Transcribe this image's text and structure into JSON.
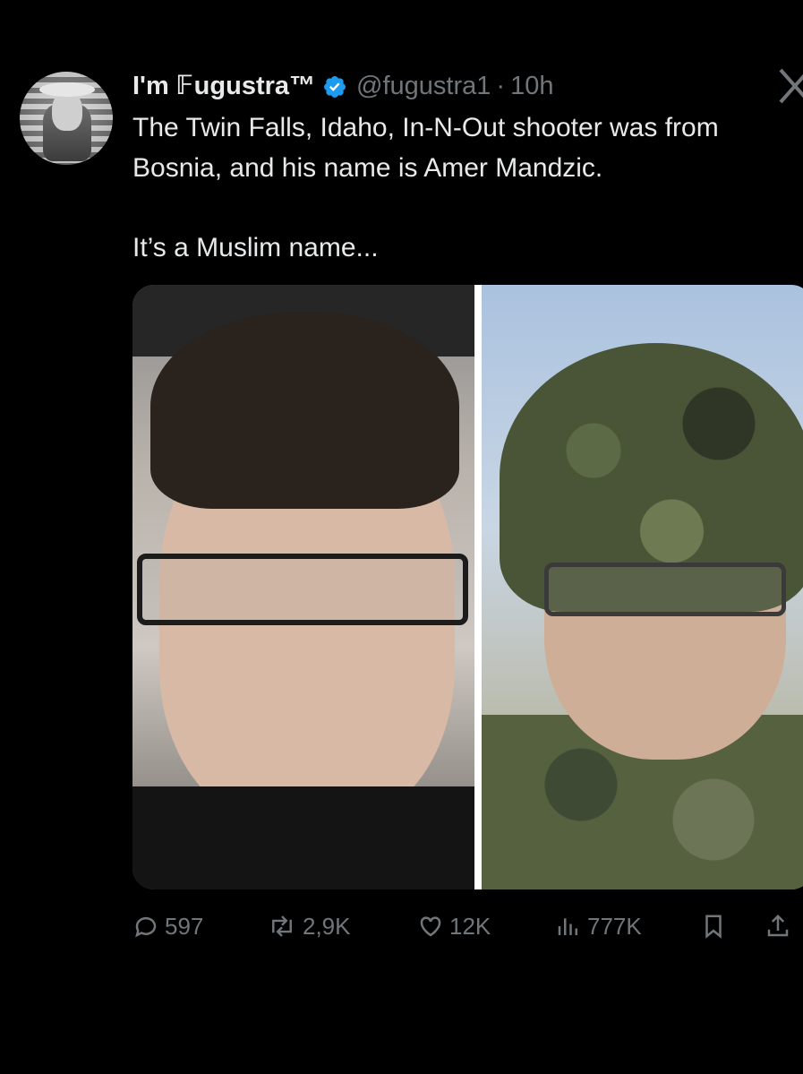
{
  "tweet": {
    "display_name": "I'm 𝔽ugustra™",
    "handle": "@fugustra1",
    "separator": "·",
    "time": "10h",
    "text_line1": "The Twin Falls, Idaho, In-N-Out shooter was from Bosnia, and his name is Amer Mandzic.",
    "text_line2": "It’s a Muslim name..."
  },
  "media": {
    "images": [
      {
        "name": "left-photo"
      },
      {
        "name": "right-photo"
      }
    ]
  },
  "actions": {
    "replies": "597",
    "reposts": "2,9K",
    "likes": "12K",
    "views": "777K"
  },
  "icons": {
    "verified": "verified-badge-icon",
    "close": "x-icon",
    "reply": "reply-icon",
    "repost": "repost-icon",
    "like": "heart-icon",
    "views": "views-icon",
    "bookmark": "bookmark-icon",
    "share": "share-icon"
  },
  "colors": {
    "background": "#000000",
    "text": "#e7e9ea",
    "muted": "#71767b",
    "verified": "#1d9bf0"
  }
}
